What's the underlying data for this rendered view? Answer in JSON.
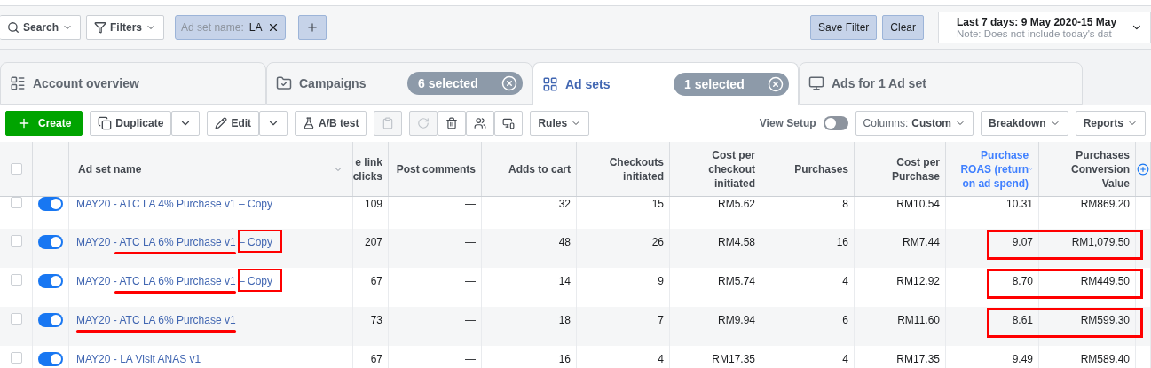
{
  "filter_bar": {
    "search": "Search",
    "filters": "Filters",
    "chip": {
      "key": "Ad set name:",
      "value": "LA"
    },
    "save": "Save Filter",
    "clear": "Clear",
    "date": {
      "range": "Last 7 days: 9 May 2020-15 May",
      "note": "Note: Does not include today's dat"
    }
  },
  "tabs": [
    {
      "kind": "overview",
      "label": "Account overview",
      "selected": false
    },
    {
      "kind": "campaigns",
      "label": "Campaigns",
      "badge": "6 selected",
      "selected": false
    },
    {
      "kind": "adsets",
      "label": "Ad sets",
      "badge": "1 selected",
      "selected": true
    },
    {
      "kind": "ads",
      "label": "Ads for 1 Ad set",
      "selected": false
    }
  ],
  "toolbar": {
    "create": "Create",
    "duplicate": "Duplicate",
    "edit": "Edit",
    "ab_test": "A/B test",
    "rules": "Rules",
    "view_setup": "View Setup",
    "view_setup_on": false,
    "columns_label": "Columns:",
    "columns_value": "Custom",
    "breakdown": "Breakdown",
    "reports": "Reports"
  },
  "table": {
    "select_all_checked": false,
    "name_column": "Ad set name",
    "columns": [
      {
        "label": "e link clicks",
        "sorted": false
      },
      {
        "label": "Post comments",
        "sorted": false
      },
      {
        "label": "Adds to cart",
        "sorted": false
      },
      {
        "label": "Checkouts initiated",
        "sorted": false
      },
      {
        "label": "Cost per checkout initiated",
        "sorted": false
      },
      {
        "label": "Purchases",
        "sorted": false
      },
      {
        "label": "Cost per Purchase",
        "sorted": false
      },
      {
        "label": "Purchase ROAS (return on ad spend)",
        "sorted": true
      },
      {
        "label": "Purchases Conversion Value",
        "sorted": false
      }
    ],
    "rows": [
      {
        "checked": false,
        "on": true,
        "name": "MAY20 - ATC LA 4% Purchase v1",
        "suffix": "– Copy",
        "underlined": false,
        "suffix_boxed": false,
        "values_boxed": false,
        "cells": [
          "109",
          "—",
          "32",
          "15",
          "RM5.62",
          "8",
          "RM10.54",
          "10.31",
          "RM869.20"
        ]
      },
      {
        "checked": false,
        "on": true,
        "name": "MAY20 - ATC LA 6% Purchase v1",
        "suffix": "– Copy",
        "underlined": true,
        "suffix_boxed": true,
        "values_boxed": true,
        "cells": [
          "207",
          "—",
          "48",
          "26",
          "RM4.58",
          "16",
          "RM7.44",
          "9.07",
          "RM1,079.50"
        ]
      },
      {
        "checked": false,
        "on": true,
        "name": "MAY20 - ATC LA 6% Purchase v1",
        "suffix": "– Copy",
        "underlined": true,
        "suffix_boxed": true,
        "values_boxed": true,
        "cells": [
          "67",
          "—",
          "14",
          "9",
          "RM5.74",
          "4",
          "RM12.92",
          "8.70",
          "RM449.50"
        ]
      },
      {
        "checked": false,
        "on": true,
        "name": "MAY20 - ATC LA 6% Purchase v1",
        "underlined": true,
        "suffix_boxed": false,
        "values_boxed": true,
        "cells": [
          "73",
          "—",
          "18",
          "7",
          "RM9.94",
          "6",
          "RM11.60",
          "8.61",
          "RM599.30"
        ]
      },
      {
        "checked": false,
        "on": true,
        "name": "MAY20 - LA Visit ANAS v1",
        "underlined": false,
        "suffix_boxed": false,
        "values_boxed": false,
        "cells": [
          "67",
          "—",
          "16",
          "4",
          "RM17.35",
          "4",
          "RM17.35",
          "9.49",
          "RM589.40"
        ]
      }
    ]
  }
}
